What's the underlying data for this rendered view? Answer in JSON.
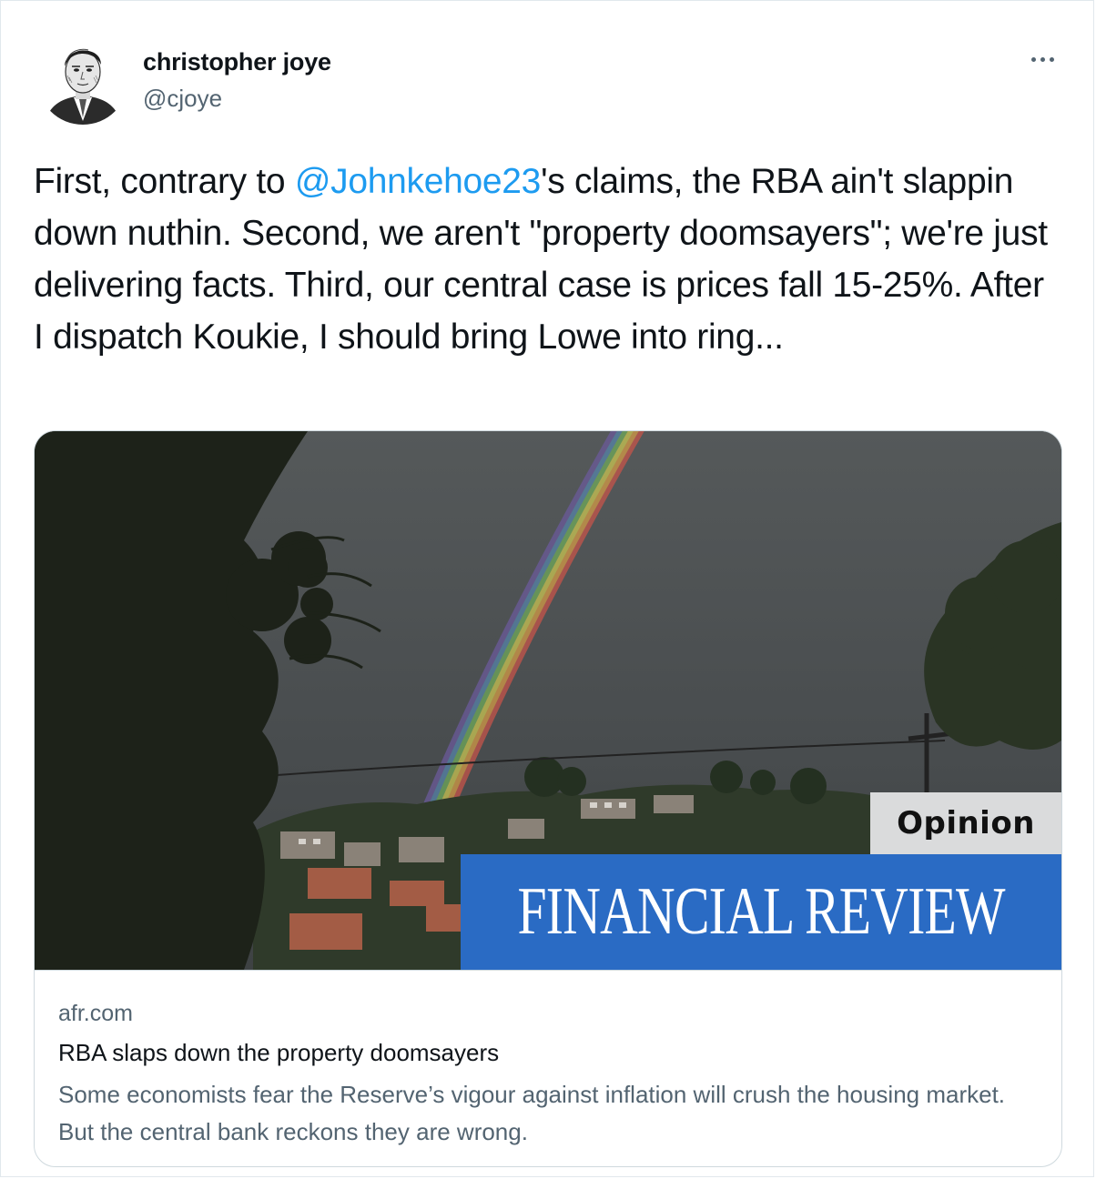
{
  "author": {
    "name": "christopher joye",
    "handle": "@cjoye"
  },
  "tweet": {
    "text_before": "First, contrary to ",
    "mention": "@Johnkehoe23",
    "text_after": "'s claims, the RBA ain't slappin down nuthin. Second, we aren't \"property doomsayers\"; we're just delivering facts. Third, our central case is prices fall 15-25%. After I dispatch Koukie, I should bring Lowe into ring..."
  },
  "card": {
    "opinion_label": "Opinion",
    "publication_banner": "FINANCIAL REVIEW",
    "domain": "afr.com",
    "title": "RBA slaps down the property doomsayers",
    "description": "Some economists fear the Reserve’s vigour against inflation will crush the housing market. But the central bank reckons they are wrong."
  },
  "icons": {
    "more": "more-options-icon",
    "avatar": "avatar-portrait"
  },
  "colors": {
    "link": "#1d9bf0",
    "text_primary": "#0f1419",
    "text_secondary": "#536471",
    "afr_blue": "#2a6bc4"
  }
}
